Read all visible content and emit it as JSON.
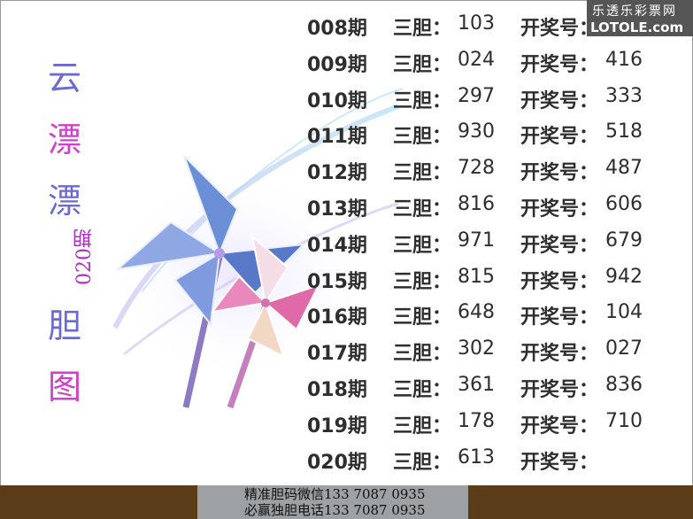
{
  "logo": {
    "line1": "乐透乐彩票网",
    "line2": "LOTOLE.com"
  },
  "vertical_title": [
    "云",
    "漂",
    "漂",
    "胆",
    "图"
  ],
  "vertical_title_colors": [
    "#6a6ad0",
    "#d040c8",
    "#6a6ad0",
    "#6a6ad0",
    "#d040c8"
  ],
  "issue_label": "020期",
  "label_sandan": "三胆：",
  "label_kaijiang": "开奖号：",
  "rows": [
    {
      "issue": "008期",
      "sandan": "103",
      "kaijiang": ""
    },
    {
      "issue": "009期",
      "sandan": "024",
      "kaijiang": "416"
    },
    {
      "issue": "010期",
      "sandan": "297",
      "kaijiang": "333"
    },
    {
      "issue": "011期",
      "sandan": "930",
      "kaijiang": "518"
    },
    {
      "issue": "012期",
      "sandan": "728",
      "kaijiang": "487"
    },
    {
      "issue": "013期",
      "sandan": "816",
      "kaijiang": "606"
    },
    {
      "issue": "014期",
      "sandan": "971",
      "kaijiang": "679"
    },
    {
      "issue": "015期",
      "sandan": "815",
      "kaijiang": "942"
    },
    {
      "issue": "016期",
      "sandan": "648",
      "kaijiang": "104"
    },
    {
      "issue": "017期",
      "sandan": "302",
      "kaijiang": "027"
    },
    {
      "issue": "018期",
      "sandan": "361",
      "kaijiang": "836"
    },
    {
      "issue": "019期",
      "sandan": "178",
      "kaijiang": "710"
    },
    {
      "issue": "020期",
      "sandan": "613",
      "kaijiang": ""
    }
  ],
  "footer": {
    "line1": "精准胆码微信133  7087  0935",
    "line2": "必赢独胆电话133  7087  0935"
  }
}
